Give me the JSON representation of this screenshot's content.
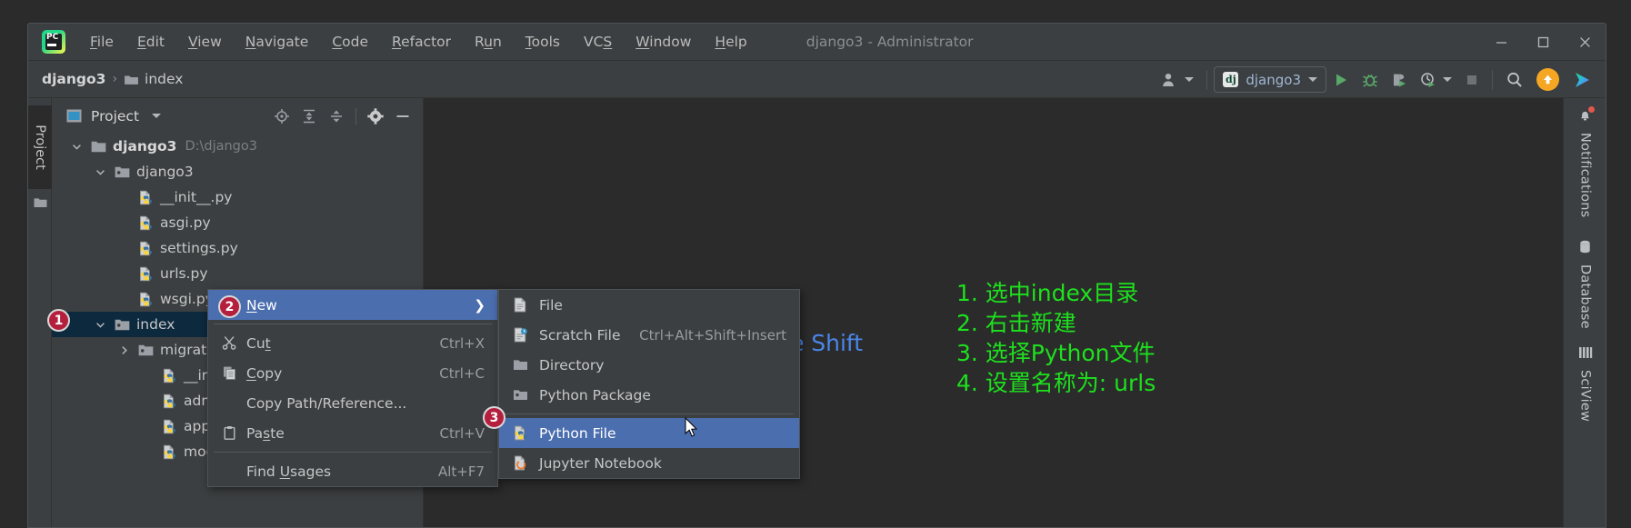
{
  "app": {
    "window_title": "django3 - Administrator",
    "logo_text": "PC"
  },
  "menubar": {
    "items": [
      {
        "label": "File",
        "accel": "F"
      },
      {
        "label": "Edit",
        "accel": "E"
      },
      {
        "label": "View",
        "accel": "V"
      },
      {
        "label": "Navigate",
        "accel": "N"
      },
      {
        "label": "Code",
        "accel": "C"
      },
      {
        "label": "Refactor",
        "accel": "R"
      },
      {
        "label": "Run",
        "accel": "u"
      },
      {
        "label": "Tools",
        "accel": "T"
      },
      {
        "label": "VCS",
        "accel": "S"
      },
      {
        "label": "Window",
        "accel": "W"
      },
      {
        "label": "Help",
        "accel": "H"
      }
    ]
  },
  "window_controls": {
    "minimize": "minimize-icon",
    "maximize": "maximize-icon",
    "close": "close-icon"
  },
  "navbar": {
    "breadcrumb": [
      {
        "label": "django3",
        "icon": ""
      },
      {
        "label": "index",
        "icon": "folder-icon"
      }
    ],
    "separator": "›",
    "run_config": {
      "icon_text": "dj",
      "name": "django3"
    },
    "buttons": [
      {
        "name": "user-icon",
        "label": ""
      },
      {
        "name": "run-button",
        "label": ""
      },
      {
        "name": "debug-button",
        "label": ""
      },
      {
        "name": "coverage-button",
        "label": ""
      },
      {
        "name": "profile-button",
        "label": ""
      },
      {
        "name": "stop-button",
        "label": ""
      },
      {
        "name": "search-button",
        "label": ""
      },
      {
        "name": "update-project-button",
        "label": ""
      },
      {
        "name": "plugin-button",
        "label": ""
      }
    ]
  },
  "sidebar_left": {
    "tab_label": "Project"
  },
  "project_panel": {
    "title": "Project",
    "header_icons": [
      "locate-icon",
      "expand-all-icon",
      "collapse-all-icon",
      "settings-gear-icon",
      "hide-icon"
    ],
    "tree": [
      {
        "label": "django3",
        "path": "D:\\django3",
        "type": "folder-root",
        "depth": 0,
        "expanded": true,
        "bold": true
      },
      {
        "label": "django3",
        "path": "",
        "type": "package",
        "depth": 1,
        "expanded": true,
        "bold": false
      },
      {
        "label": "__init__.py",
        "path": "",
        "type": "python",
        "depth": 2,
        "expanded": null,
        "bold": false
      },
      {
        "label": "asgi.py",
        "path": "",
        "type": "python",
        "depth": 2,
        "expanded": null,
        "bold": false
      },
      {
        "label": "settings.py",
        "path": "",
        "type": "python",
        "depth": 2,
        "expanded": null,
        "bold": false
      },
      {
        "label": "urls.py",
        "path": "",
        "type": "python",
        "depth": 2,
        "expanded": null,
        "bold": false
      },
      {
        "label": "wsgi.py",
        "path": "",
        "type": "python",
        "depth": 2,
        "expanded": null,
        "bold": false
      },
      {
        "label": "index",
        "path": "",
        "type": "package",
        "depth": 1,
        "expanded": true,
        "bold": false,
        "selected": true
      },
      {
        "label": "migrations",
        "path": "",
        "type": "package",
        "depth": 2,
        "expanded": false,
        "bold": false
      },
      {
        "label": "__init__.py",
        "path": "",
        "type": "python",
        "depth": 3,
        "expanded": null,
        "bold": false
      },
      {
        "label": "admin.py",
        "path": "",
        "type": "python",
        "depth": 3,
        "expanded": null,
        "bold": false
      },
      {
        "label": "apps.py",
        "path": "",
        "type": "python",
        "depth": 3,
        "expanded": null,
        "bold": false
      },
      {
        "label": "models.py",
        "path": "",
        "type": "python",
        "depth": 3,
        "expanded": null,
        "bold": false
      }
    ]
  },
  "context_menu": {
    "items": [
      {
        "label": "New",
        "accel": "N",
        "shortcut": "",
        "icon": "",
        "submenu": true,
        "selected": true
      },
      {
        "separator": true
      },
      {
        "label": "Cut",
        "accel": "t",
        "shortcut": "Ctrl+X",
        "icon": "scissors-icon"
      },
      {
        "label": "Copy",
        "accel": "C",
        "shortcut": "Ctrl+C",
        "icon": "copy-icon"
      },
      {
        "label": "Copy Path/Reference...",
        "accel": "",
        "shortcut": "",
        "icon": ""
      },
      {
        "label": "Paste",
        "accel": "s",
        "shortcut": "Ctrl+V",
        "icon": "paste-icon"
      },
      {
        "separator": true
      },
      {
        "label": "Find Usages",
        "accel": "U",
        "shortcut": "Alt+F7",
        "icon": ""
      }
    ]
  },
  "submenu": {
    "items": [
      {
        "label": "File",
        "shortcut": "",
        "icon": "file-icon"
      },
      {
        "label": "Scratch File",
        "shortcut": "Ctrl+Alt+Shift+Insert",
        "icon": "scratch-file-icon"
      },
      {
        "label": "Directory",
        "shortcut": "",
        "icon": "directory-icon"
      },
      {
        "label": "Python Package",
        "shortcut": "",
        "icon": "python-package-icon"
      },
      {
        "separator": true
      },
      {
        "label": "Python File",
        "shortcut": "",
        "icon": "python-file-icon",
        "selected": true
      },
      {
        "label": "Jupyter Notebook",
        "shortcut": "",
        "icon": "jupyter-icon"
      }
    ]
  },
  "sidebar_right": {
    "tabs": [
      {
        "label": "Notifications",
        "icon": "bell-icon",
        "badge": true
      },
      {
        "label": "Database",
        "icon": "database-icon",
        "badge": false
      },
      {
        "label": "SciView",
        "icon": "sciview-icon",
        "badge": false
      }
    ]
  },
  "annotations": {
    "color": "#1ee01e",
    "lines": [
      "1. 选中index目录",
      "2. 右击新建",
      "3. 选择Python文件",
      "4. 设置名称为: urls"
    ],
    "badges": [
      "1",
      "2",
      "3"
    ],
    "badge_color": "#b51f3e"
  },
  "editor_hint": {
    "text": "le Shift",
    "color": "#4a86e8"
  }
}
